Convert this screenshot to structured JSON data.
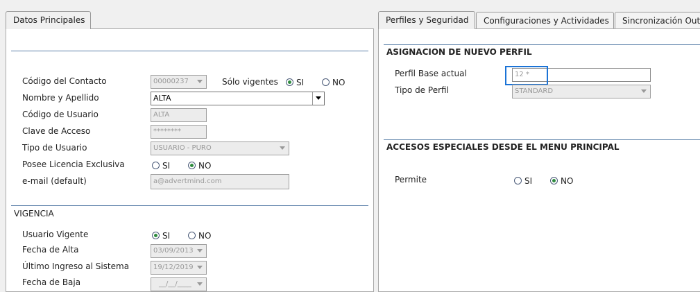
{
  "tabs_left": {
    "datos_principales": "Datos Principales"
  },
  "tabs_right": {
    "perfiles": "Perfiles y Seguridad",
    "configuraciones": "Configuraciones y Actividades",
    "sincronizacion": "Sincronización Outl"
  },
  "contacto": {
    "codigo_label": "Código del Contacto",
    "codigo_value": "00000237",
    "solo_vigentes_label": "Sólo vigentes",
    "solo_vigentes_si": "SI",
    "solo_vigentes_no": "NO",
    "solo_vigentes_selected": "SI",
    "nombre_label": "Nombre y Apellido",
    "nombre_value": "ALTA",
    "codigo_usuario_label": "Código de Usuario",
    "codigo_usuario_value": "ALTA",
    "clave_label": "Clave de Acceso",
    "clave_value": "********",
    "tipo_usuario_label": "Tipo de Usuario",
    "tipo_usuario_value": "USUARIO - PURO",
    "licencia_label": "Posee Licencia Exclusiva",
    "licencia_si": "SI",
    "licencia_no": "NO",
    "licencia_selected": "NO",
    "email_label": "e-mail (default)",
    "email_value": "a@advertmind.com"
  },
  "vigencia": {
    "title": "VIGENCIA",
    "usuario_vigente_label": "Usuario Vigente",
    "usuario_vigente_si": "SI",
    "usuario_vigente_no": "NO",
    "usuario_vigente_selected": "SI",
    "fecha_alta_label": "Fecha de Alta",
    "fecha_alta_value": "03/09/2013",
    "ultimo_ingreso_label": "Último Ingreso al Sistema",
    "ultimo_ingreso_value": "19/12/2019",
    "fecha_baja_label": "Fecha de Baja",
    "fecha_baja_value": "__/__/____"
  },
  "perfil": {
    "title": "ASIGNACION DE NUEVO PERFIL",
    "base_label": "Perfil Base actual",
    "base_value": "12 *",
    "tipo_label": "Tipo de Perfil",
    "tipo_value": "STANDARD"
  },
  "accesos": {
    "title": "ACCESOS ESPECIALES DESDE EL MENU PRINCIPAL",
    "permite_label": "Permite",
    "permite_si": "SI",
    "permite_no": "NO",
    "permite_selected": "NO"
  },
  "colors": {
    "focus": "#1b73d6",
    "radio_dot": "#2e8b3e",
    "rule": "#5a7fa8"
  }
}
